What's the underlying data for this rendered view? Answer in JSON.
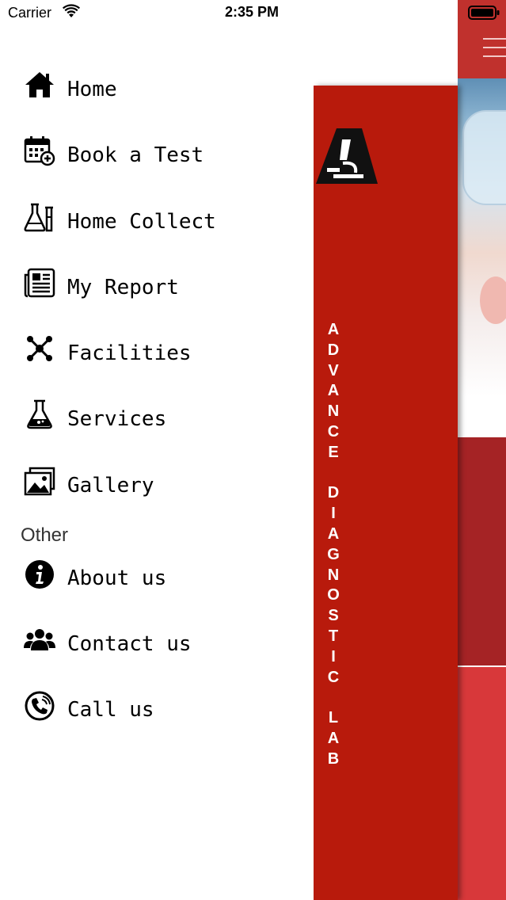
{
  "status_bar": {
    "carrier": "Carrier",
    "time": "2:35 PM"
  },
  "menu": {
    "items": [
      {
        "label": "Home",
        "icon": "home-icon"
      },
      {
        "label": "Book a Test",
        "icon": "calendar-add-icon"
      },
      {
        "label": "Home Collect",
        "icon": "lab-flasks-icon"
      },
      {
        "label": "My Report",
        "icon": "report-icon"
      },
      {
        "label": "Facilities",
        "icon": "network-icon"
      },
      {
        "label": "Services",
        "icon": "flask-icon"
      },
      {
        "label": "Gallery",
        "icon": "gallery-icon"
      }
    ],
    "other_section_title": "Other",
    "other_items": [
      {
        "label": "About us",
        "icon": "info-icon"
      },
      {
        "label": "Contact us",
        "icon": "users-icon"
      },
      {
        "label": "Call us",
        "icon": "phone-icon"
      }
    ]
  },
  "banner": {
    "vertical_text": "ADVANCE DIAGNOSTIC LAB",
    "background_color": "#b81a0c"
  },
  "colors": {
    "nav_bar": "#c0312d",
    "dark_red": "#a52325",
    "red": "#d8383a"
  }
}
